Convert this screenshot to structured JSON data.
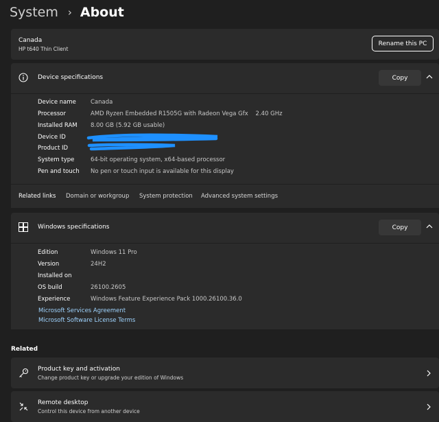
{
  "breadcrumb": {
    "parent": "System",
    "separator": "›",
    "current": "About"
  },
  "pc_card": {
    "name": "Canada",
    "model": "HP t640 Thin Client",
    "rename_label": "Rename this PC"
  },
  "device_specs": {
    "title": "Device specifications",
    "copy_label": "Copy",
    "rows": [
      {
        "label": "Device name",
        "value": "Canada"
      },
      {
        "label": "Processor",
        "value": "AMD Ryzen Embedded R1505G with Radeon Vega Gfx    2.40 GHz"
      },
      {
        "label": "Installed RAM",
        "value": "8.00 GB (5.92 GB usable)"
      },
      {
        "label": "Device ID",
        "value": ""
      },
      {
        "label": "Product ID",
        "value": ""
      },
      {
        "label": "System type",
        "value": "64-bit operating system, x64-based processor"
      },
      {
        "label": "Pen and touch",
        "value": "No pen or touch input is available for this display"
      }
    ]
  },
  "related_links": {
    "label": "Related links",
    "links": [
      "Domain or workgroup",
      "System protection",
      "Advanced system settings"
    ]
  },
  "windows_specs": {
    "title": "Windows specifications",
    "copy_label": "Copy",
    "rows": [
      {
        "label": "Edition",
        "value": "Windows 11 Pro"
      },
      {
        "label": "Version",
        "value": "24H2"
      },
      {
        "label": "Installed on",
        "value": ""
      },
      {
        "label": "OS build",
        "value": "26100.2605"
      },
      {
        "label": "Experience",
        "value": "Windows Feature Experience Pack 1000.26100.36.0"
      }
    ],
    "links": [
      "Microsoft Services Agreement",
      "Microsoft Software License Terms"
    ]
  },
  "related": {
    "title": "Related",
    "items": [
      {
        "title": "Product key and activation",
        "subtitle": "Change product key or upgrade your edition of Windows",
        "icon": "key-icon"
      },
      {
        "title": "Remote desktop",
        "subtitle": "Control this device from another device",
        "icon": "remote-desktop-icon"
      }
    ]
  },
  "colors": {
    "background": "#1f1f1f",
    "card": "#2b2b2b",
    "link": "#9fd4ff",
    "redaction": "#1e90ff"
  }
}
